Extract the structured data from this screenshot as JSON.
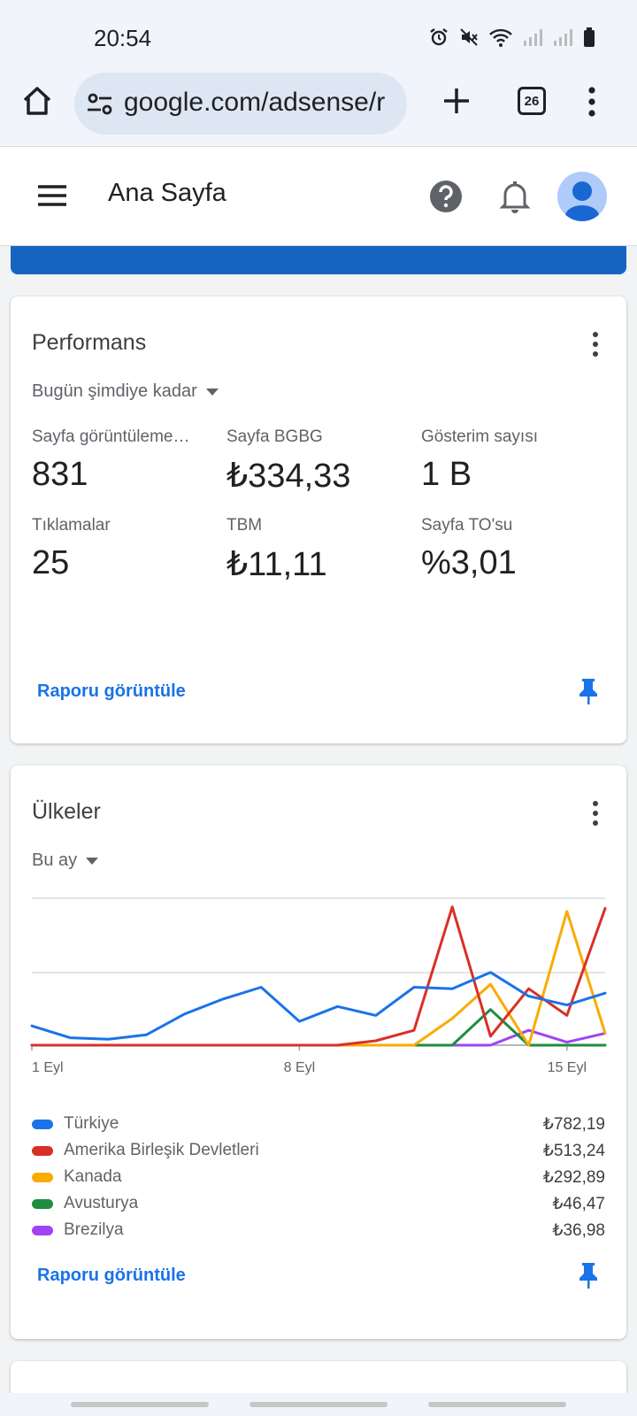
{
  "status": {
    "time": "20:54"
  },
  "browser": {
    "url": "google.com/adsense/r",
    "tab_count": "26"
  },
  "header": {
    "title": "Ana Sayfa"
  },
  "performance": {
    "title": "Performans",
    "range": "Bugün şimdiye kadar",
    "metrics": [
      {
        "label": "Sayfa görüntüleme…",
        "value": "831"
      },
      {
        "label": "Sayfa BGBG",
        "value": "₺334,33"
      },
      {
        "label": "Gösterim sayısı",
        "value": "1 B"
      },
      {
        "label": "Tıklamalar",
        "value": "25"
      },
      {
        "label": "TBM",
        "value": "₺11,11"
      },
      {
        "label": "Sayfa TO'su",
        "value": "%3,01"
      }
    ],
    "view_report": "Raporu görüntüle"
  },
  "countries": {
    "title": "Ülkeler",
    "range": "Bu ay",
    "view_report": "Raporu görüntüle",
    "legend": [
      {
        "name": "Türkiye",
        "value": "₺782,19",
        "color": "#1a73e8"
      },
      {
        "name": "Amerika Birleşik Devletleri",
        "value": "₺513,24",
        "color": "#d93025"
      },
      {
        "name": "Kanada",
        "value": "₺292,89",
        "color": "#f9ab00"
      },
      {
        "name": "Avusturya",
        "value": "₺46,47",
        "color": "#1e8e3e"
      },
      {
        "name": "Brezilya",
        "value": "₺36,98",
        "color": "#a142f4"
      }
    ]
  },
  "chart_data": {
    "type": "line",
    "x": [
      1,
      2,
      3,
      4,
      5,
      6,
      7,
      8,
      9,
      10,
      11,
      12,
      13,
      14,
      15,
      16
    ],
    "xticks": [
      "1 Eyl",
      "8 Eyl",
      "15 Eyl"
    ],
    "xtick_positions": [
      1,
      8,
      15
    ],
    "ylim": [
      0,
      100
    ],
    "grid": true,
    "series": [
      {
        "name": "Türkiye",
        "color": "#1a73e8",
        "values": [
          13,
          5,
          4,
          7,
          21,
          31,
          39,
          16,
          26,
          20,
          39,
          38,
          49,
          33,
          27,
          35
        ]
      },
      {
        "name": "Amerika Birleşik Devletleri",
        "color": "#d93025",
        "values": [
          0,
          0,
          0,
          0,
          0,
          0,
          0,
          0,
          0,
          3,
          10,
          93,
          6,
          38,
          20,
          92
        ]
      },
      {
        "name": "Kanada",
        "color": "#f9ab00",
        "values": [
          0,
          0,
          0,
          0,
          0,
          0,
          0,
          0,
          0,
          0,
          0,
          18,
          41,
          0,
          90,
          8
        ]
      },
      {
        "name": "Avusturya",
        "color": "#1e8e3e",
        "values": [
          0,
          0,
          0,
          0,
          0,
          0,
          0,
          0,
          0,
          0,
          0,
          0,
          24,
          0,
          0,
          0
        ]
      },
      {
        "name": "Brezilya",
        "color": "#a142f4",
        "values": [
          0,
          0,
          0,
          0,
          0,
          0,
          0,
          0,
          0,
          0,
          0,
          0,
          0,
          10,
          2,
          8
        ]
      }
    ]
  }
}
